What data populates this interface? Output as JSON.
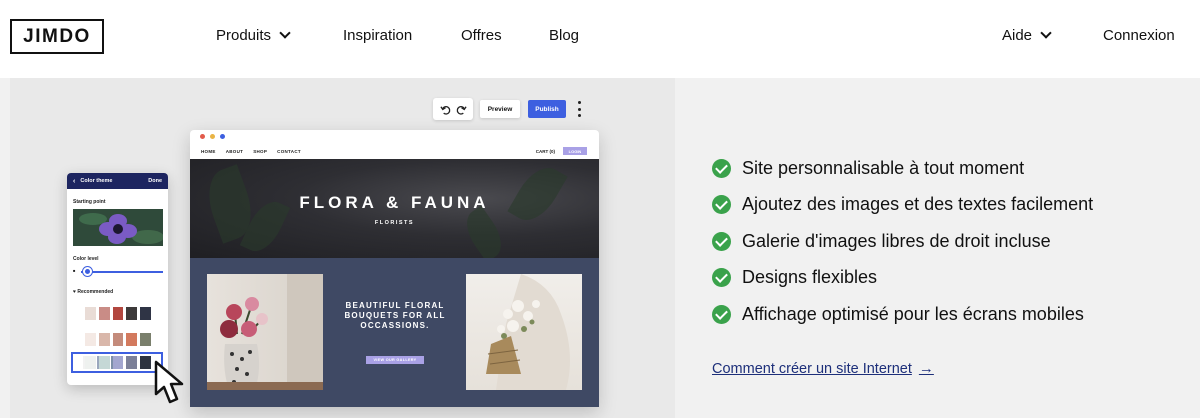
{
  "header": {
    "logo": "JIMDO",
    "nav": [
      {
        "label": "Produits",
        "dropdown": true
      },
      {
        "label": "Inspiration"
      },
      {
        "label": "Offres"
      },
      {
        "label": "Blog"
      }
    ],
    "right": [
      {
        "label": "Aide",
        "dropdown": true
      },
      {
        "label": "Connexion"
      }
    ]
  },
  "editor": {
    "toolbar": {
      "preview": "Preview",
      "publish": "Publish"
    },
    "site": {
      "nav": [
        "HOME",
        "ABOUT",
        "SHOP",
        "CONTACT"
      ],
      "cart": "CART (0)",
      "login": "LOGIN",
      "hero_title": "FLORA & FAUNA",
      "hero_subtitle": "FLORISTS",
      "promo_text": "BEAUTIFUL FLORAL BOUQUETS FOR ALL OCCASSIONS.",
      "gallery_button": "VIEW OUR GALLERY"
    },
    "panel": {
      "title": "Color theme",
      "done": "Done",
      "starting_point": "Starting point",
      "color_level": "Color level",
      "recommended": "Recommended",
      "color_level_value": 0.1,
      "palettes": [
        [
          "#e9dcd6",
          "#c98c86",
          "#b2473f",
          "#3d3a3a",
          "#2f3445"
        ],
        [
          "#f2f2f2",
          "#9aa7bd",
          "#7d8fa8",
          "#455066",
          "#1f2333"
        ],
        [
          "#f4e9e4",
          "#d9b7aa",
          "#c48b7b",
          "#d37a5e",
          "#7a7f6c"
        ],
        [
          "#eef1ef",
          "#c5d8d6",
          "#a3a6cf",
          "#7c8098",
          "#2e3440"
        ]
      ]
    }
  },
  "features": [
    "Site personnalisable à tout moment",
    "Ajoutez des images et des textes facilement",
    "Galerie d'images libres de droit incluse",
    "Designs flexibles",
    "Affichage optimisé pour les écrans mobiles"
  ],
  "link": {
    "label": "Comment créer un site Internet",
    "arrow": "→"
  },
  "colors": {
    "accent_blue": "#3d5fe0",
    "check_green": "#3aa24b",
    "link_navy": "#1d2f7a",
    "site_navy": "#3f4964"
  }
}
